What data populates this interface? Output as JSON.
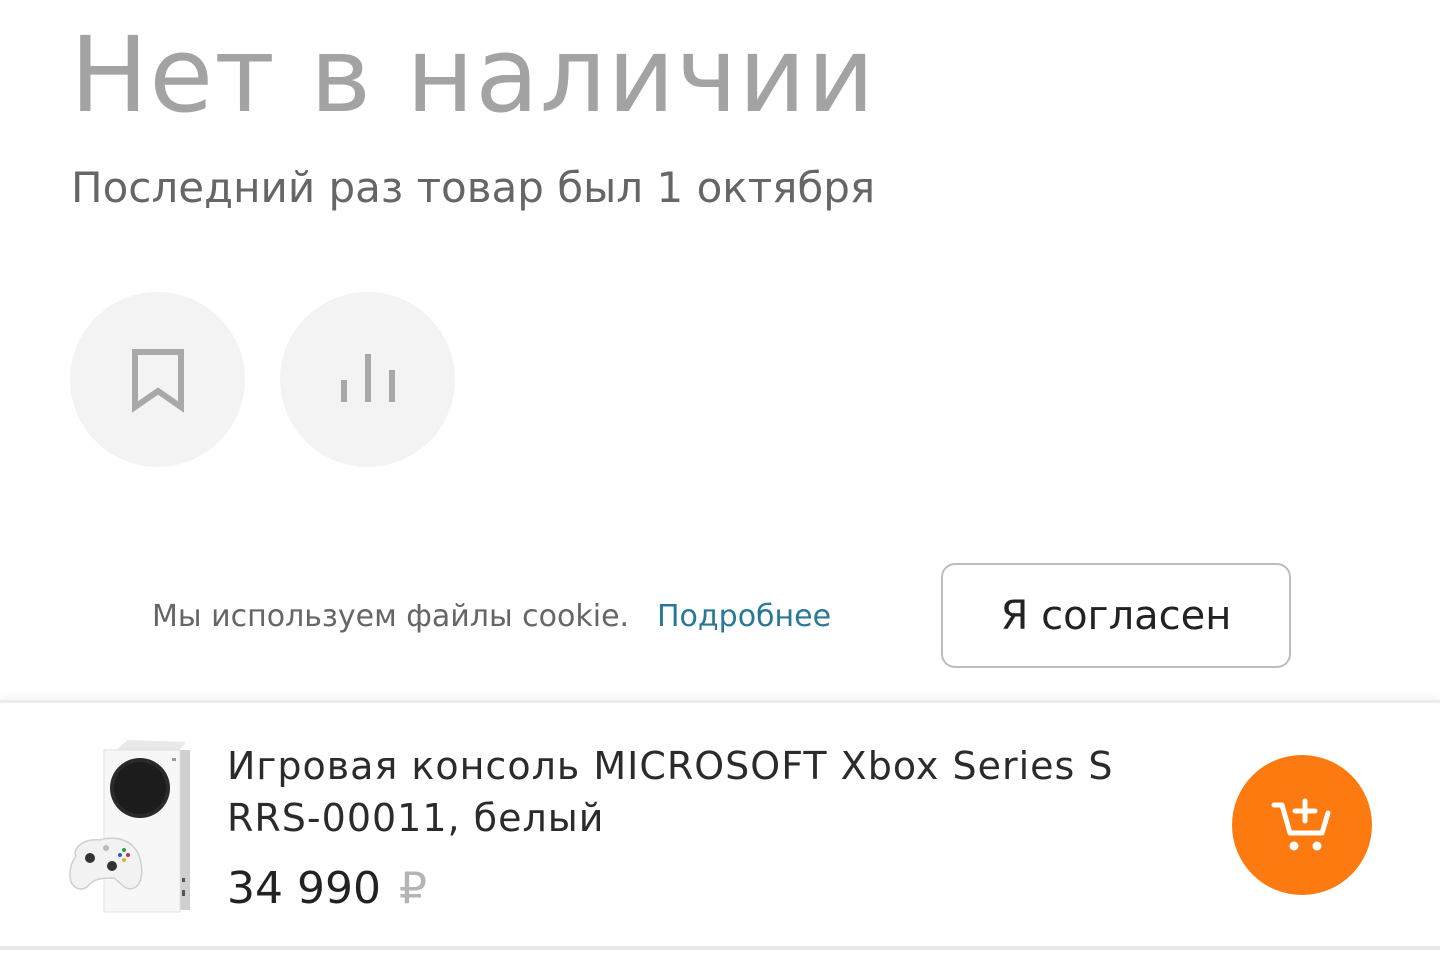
{
  "status": {
    "title": "Нет в наличии",
    "last_seen": "Последний раз товар был 1 октября"
  },
  "actions": {
    "favorite_icon": "bookmark-icon",
    "compare_icon": "bar-chart-icon"
  },
  "cookie": {
    "text": "Мы используем файлы cookie.",
    "link_label": "Подробнее",
    "agree_label": "Я согласен",
    "link_color": "#2a7898"
  },
  "product": {
    "name": "Игровая консоль MICROSOFT Xbox Series S RRS-00011, белый",
    "price": "34 990",
    "currency": "₽",
    "image_icon": "xbox-console-image",
    "cart_icon": "add-to-cart-icon",
    "cart_color": "#fc7a0f"
  }
}
